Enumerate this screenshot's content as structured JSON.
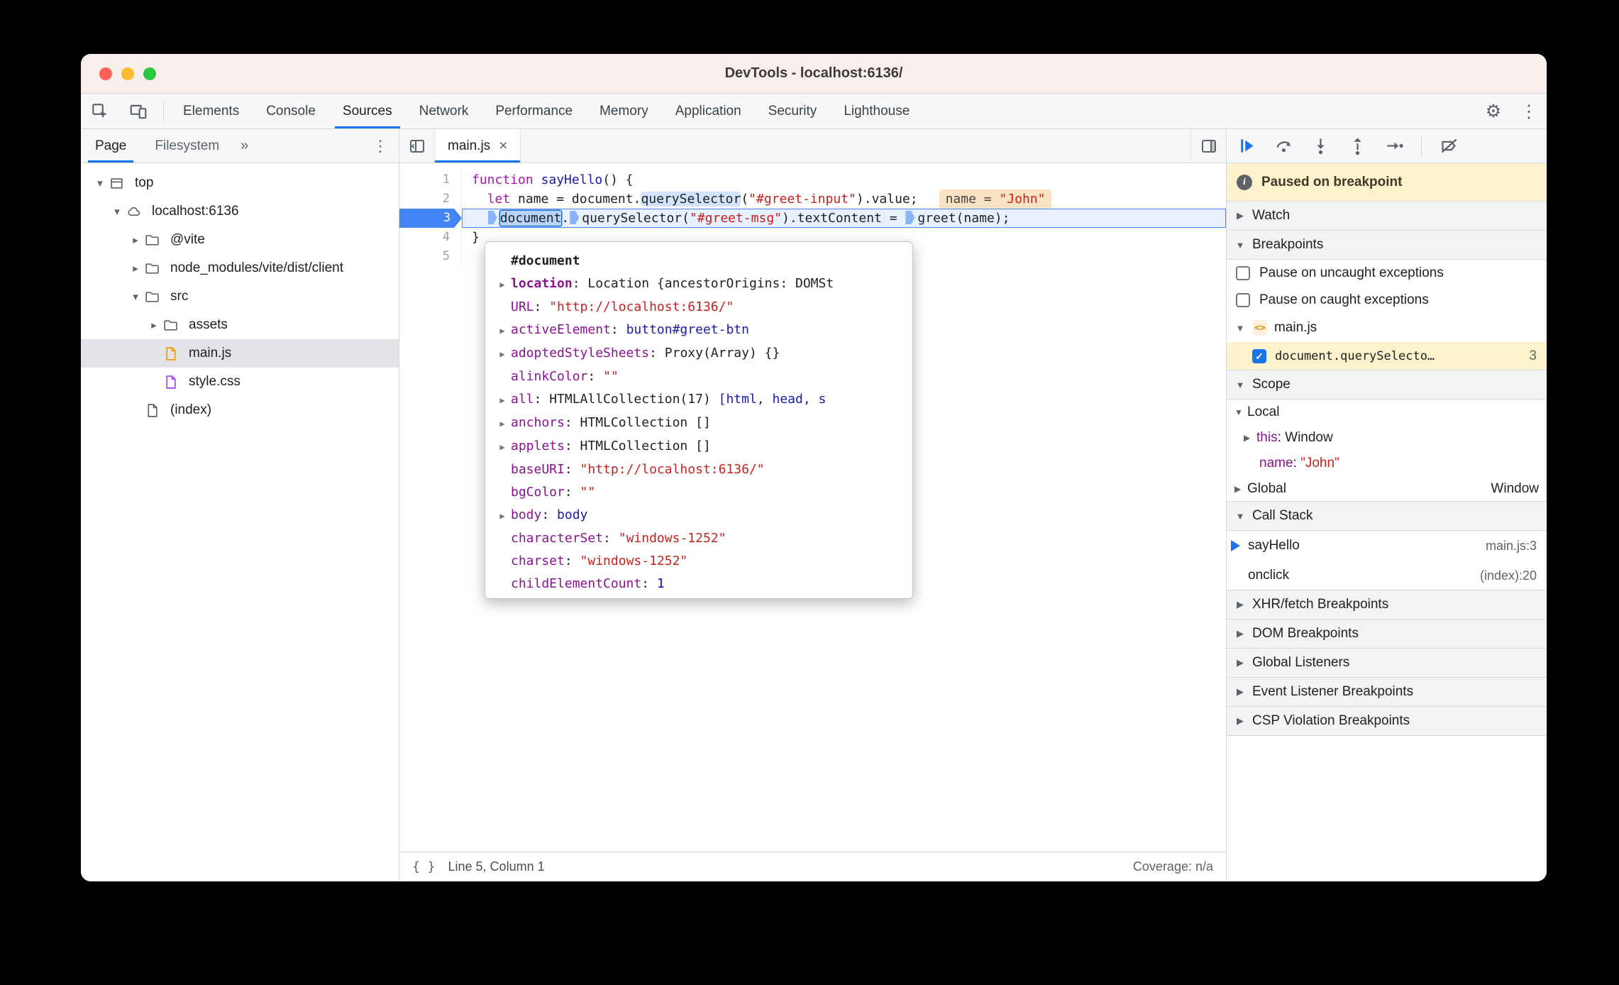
{
  "window": {
    "title": "DevTools - localhost:6136/"
  },
  "icons": {
    "kebab": "⋮",
    "gear": "⚙",
    "overflow": "»",
    "close_tab": "×",
    "braces": "{ }",
    "info": "i",
    "check": "✓"
  },
  "main_toolbar": {
    "tabs": [
      "Elements",
      "Console",
      "Sources",
      "Network",
      "Performance",
      "Memory",
      "Application",
      "Security",
      "Lighthouse"
    ]
  },
  "navigator": {
    "tab_page": "Page",
    "tab_filesystem": "Filesystem",
    "tree": [
      {
        "exp": "▾",
        "label": "top"
      },
      {
        "exp": "▾",
        "label": "localhost:6136"
      },
      {
        "exp": "▸",
        "label": "@vite"
      },
      {
        "exp": "▸",
        "label": "node_modules/vite/dist/client"
      },
      {
        "exp": "▾",
        "label": "src"
      },
      {
        "exp": "▸",
        "label": "assets"
      },
      {
        "exp": "",
        "label": "main.js"
      },
      {
        "exp": "",
        "label": "style.css"
      },
      {
        "exp": "",
        "label": "(index)"
      }
    ]
  },
  "editor": {
    "tab": "main.js",
    "lines": [
      {
        "num": "1",
        "tokens": [
          "function",
          " ",
          "sayHello",
          "() {"
        ]
      },
      {
        "num": "2",
        "tokens": [
          "  ",
          "let",
          " name = document.",
          "querySelector",
          "(",
          "\"#greet-input\"",
          ").value;"
        ],
        "hint_name": "name = ",
        "hint_value": "\"John\""
      },
      {
        "num": "3",
        "tokens": [
          "  ",
          "document",
          ".",
          "querySelector",
          "(",
          "\"#greet-msg\"",
          ").textContent = ",
          "greet(name);"
        ]
      },
      {
        "num": "4",
        "tokens": [
          "}"
        ]
      },
      {
        "num": "5",
        "tokens": []
      }
    ],
    "status": {
      "line_col": "Line 5, Column 1",
      "coverage": "Coverage: n/a"
    }
  },
  "popup": {
    "title": "#document",
    "sep": ": ",
    "rows": [
      {
        "arrow": "▶",
        "name": "location",
        "value": "Location {ancestorOrigins: DOMSt"
      },
      {
        "arrow": "",
        "name": "URL",
        "value": "\"http://localhost:6136/\""
      },
      {
        "arrow": "▶",
        "name": "activeElement",
        "value": "button#greet-btn"
      },
      {
        "arrow": "▶",
        "name": "adoptedStyleSheets",
        "value": "Proxy(Array) {}"
      },
      {
        "arrow": "",
        "name": "alinkColor",
        "value": "\"\""
      },
      {
        "arrow": "▶",
        "name": "all",
        "value": "HTMLAllCollection(17) ",
        "value2": "[html, head, s"
      },
      {
        "arrow": "▶",
        "name": "anchors",
        "value": "HTMLCollection []"
      },
      {
        "arrow": "▶",
        "name": "applets",
        "value": "HTMLCollection []"
      },
      {
        "arrow": "",
        "name": "baseURI",
        "value": "\"http://localhost:6136/\""
      },
      {
        "arrow": "",
        "name": "bgColor",
        "value": "\"\""
      },
      {
        "arrow": "▶",
        "name": "body",
        "value": "body"
      },
      {
        "arrow": "",
        "name": "characterSet",
        "value": "\"windows-1252\""
      },
      {
        "arrow": "",
        "name": "charset",
        "value": "\"windows-1252\""
      },
      {
        "arrow": "",
        "name": "childElementCount",
        "value": "1"
      }
    ]
  },
  "debugger": {
    "banner": "Paused on breakpoint",
    "sections": [
      {
        "arrow": "▶",
        "label": "Watch"
      },
      {
        "arrow": "▼",
        "label": "Breakpoints"
      },
      {
        "arrow": "▼",
        "label": "Scope"
      },
      {
        "arrow": "▼",
        "label": "Call Stack"
      },
      {
        "arrow": "▶",
        "label": "XHR/fetch Breakpoints"
      },
      {
        "arrow": "▶",
        "label": "DOM Breakpoints"
      },
      {
        "arrow": "▶",
        "label": "Global Listeners"
      },
      {
        "arrow": "▶",
        "label": "Event Listener Breakpoints"
      },
      {
        "arrow": "▶",
        "label": "CSP Violation Breakpoints"
      }
    ],
    "breakpoints": {
      "pause_uncaught": "Pause on uncaught exceptions",
      "pause_caught": "Pause on caught exceptions",
      "group_arrow": "▼",
      "file": "main.js",
      "file_icon": "<>",
      "entry": "document.querySelecto…",
      "entry_line": "3"
    },
    "scope": {
      "local_arrow": "▼",
      "local": "Local",
      "this_arrow": "▶",
      "this_name": "this",
      "sep": ": ",
      "this_value": "Window",
      "name_name": "name",
      "name_value": "\"John\"",
      "global_arrow": "▶",
      "global": "Global",
      "global_value": "Window"
    },
    "call_stack": [
      {
        "fn": "sayHello",
        "loc": "main.js:3"
      },
      {
        "fn": "onclick",
        "loc": "(index):20"
      }
    ]
  }
}
